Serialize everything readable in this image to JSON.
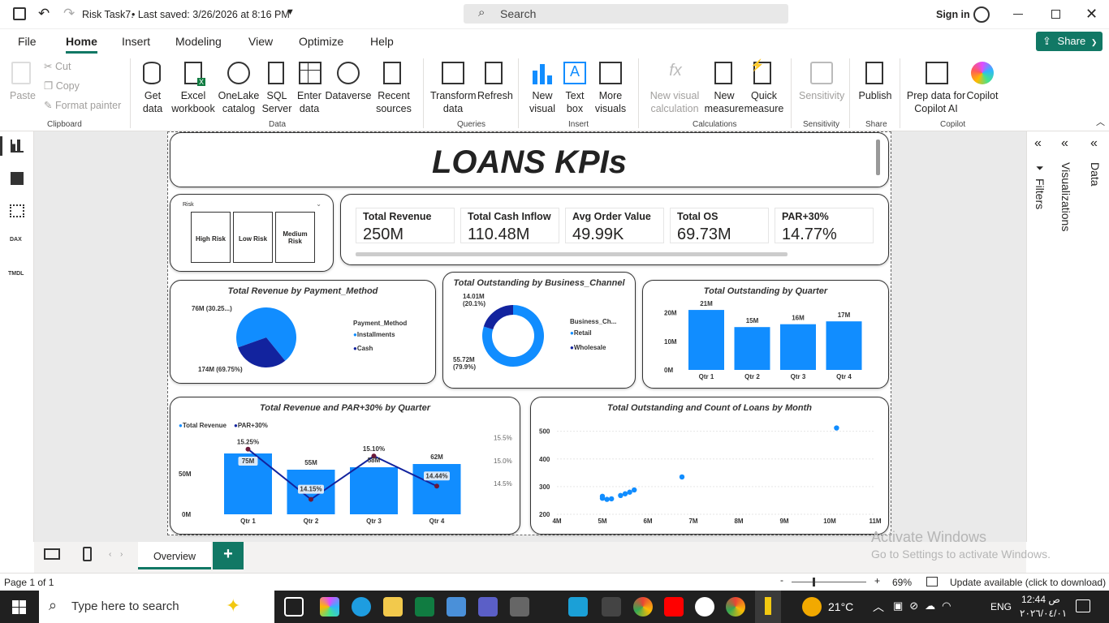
{
  "titlebar": {
    "file_title": "Risk Task7.",
    "saved": "• Last saved: 3/26/2026 at 8:16 PM",
    "search": "Search",
    "signin": "Sign in"
  },
  "menu": {
    "items": [
      "File",
      "Home",
      "Insert",
      "Modeling",
      "View",
      "Optimize",
      "Help"
    ],
    "share": "Share"
  },
  "ribbon": {
    "clipboard": {
      "paste": "Paste",
      "cut": "Cut",
      "copy": "Copy",
      "format_painter": "Format painter",
      "group": "Clipboard"
    },
    "data": {
      "get_data": "Get data",
      "excel": "Excel workbook",
      "onelake": "OneLake catalog",
      "sql": "SQL Server",
      "enter": "Enter data",
      "dataverse": "Dataverse",
      "recent": "Recent sources",
      "group": "Data"
    },
    "queries": {
      "transform": "Transform data",
      "refresh": "Refresh",
      "group": "Queries"
    },
    "insert": {
      "new_visual": "New visual",
      "text_box": "Text box",
      "more_visuals": "More visuals",
      "group": "Insert"
    },
    "calculations": {
      "new_visual_calc": "New visual calculation",
      "new_measure": "New measure",
      "quick_measure": "Quick measure",
      "group": "Calculations"
    },
    "sensitivity": {
      "label": "Sensitivity",
      "group": "Sensitivity"
    },
    "share": {
      "publish": "Publish",
      "group": "Share"
    },
    "copilot": {
      "prep": "Prep data for Copilot AI",
      "copilot": "Copilot",
      "group": "Copilot"
    }
  },
  "report": {
    "title": "LOANS KPIs",
    "slicer": {
      "label": "Risk",
      "options": [
        "High Risk",
        "Low Risk",
        "Medium Risk"
      ]
    },
    "kpis": [
      {
        "label": "Total Revenue",
        "value": "250M"
      },
      {
        "label": "Total Cash Inflow",
        "value": "110.48M"
      },
      {
        "label": "Avg Order Value",
        "value": "49.99K"
      },
      {
        "label": "Total OS",
        "value": "69.73M"
      },
      {
        "label": "PAR+30%",
        "value": "14.77%"
      }
    ]
  },
  "chart_data": [
    {
      "type": "pie",
      "title": "Total Revenue by Payment_Method",
      "legend_title": "Payment_Method",
      "slices": [
        {
          "name": "Installments",
          "value": 174,
          "label": "174M (69.75%)",
          "color": "#118dff"
        },
        {
          "name": "Cash",
          "value": 76,
          "label": "76M (30.25...)",
          "color": "#12239e"
        }
      ]
    },
    {
      "type": "pie",
      "title": "Total Outstanding by Business_Channel",
      "legend_title": "Business_Ch...",
      "slices": [
        {
          "name": "Retail",
          "value": 55.72,
          "label": "55.72M (79.9%)",
          "color": "#118dff"
        },
        {
          "name": "Wholesale",
          "value": 14.01,
          "label": "14.01M (20.1%)",
          "color": "#12239e"
        }
      ]
    },
    {
      "type": "bar",
      "title": "Total Outstanding by Quarter",
      "categories": [
        "Qtr 1",
        "Qtr 2",
        "Qtr 3",
        "Qtr 4"
      ],
      "values": [
        21,
        15,
        16,
        17
      ],
      "data_labels": [
        "21M",
        "15M",
        "16M",
        "17M"
      ],
      "yticks": [
        "0M",
        "10M",
        "20M"
      ],
      "ylim": [
        0,
        25
      ]
    },
    {
      "type": "bar",
      "title": "Total Revenue and PAR+30% by Quarter",
      "categories": [
        "Qtr 1",
        "Qtr 2",
        "Qtr 3",
        "Qtr 4"
      ],
      "series": [
        {
          "name": "Total Revenue",
          "values": [
            75,
            55,
            58,
            62
          ],
          "labels": [
            "75M",
            "55M",
            "58M",
            "62M"
          ]
        },
        {
          "name": "PAR+30%",
          "values": [
            15.25,
            14.15,
            15.1,
            14.44
          ],
          "labels": [
            "15.25%",
            "14.15%",
            "15.10%",
            "14.44%"
          ]
        }
      ],
      "yticks": [
        "0M",
        "50M"
      ],
      "y2ticks": [
        "14.5%",
        "15.0%",
        "15.5%"
      ]
    },
    {
      "type": "scatter",
      "title": "Total Outstanding and Count of Loans by Month",
      "xticks": [
        "4M",
        "5M",
        "6M",
        "7M",
        "8M",
        "9M",
        "10M",
        "11M"
      ],
      "yticks": [
        "200",
        "300",
        "400",
        "500"
      ],
      "points": [
        [
          5.0,
          258
        ],
        [
          5.0,
          265
        ],
        [
          5.1,
          254
        ],
        [
          5.2,
          256
        ],
        [
          5.4,
          268
        ],
        [
          5.5,
          274
        ],
        [
          5.6,
          280
        ],
        [
          5.7,
          288
        ],
        [
          6.75,
          335
        ],
        [
          10.15,
          512
        ]
      ],
      "xlim": [
        4,
        11
      ],
      "ylim": [
        200,
        540
      ]
    }
  ],
  "pages": {
    "tab": "Overview",
    "page": "Page 1 of 1",
    "zoom": "69%",
    "update": "Update available (click to download)"
  },
  "panes": {
    "filters": "Filters",
    "visualizations": "Visualizations",
    "data": "Data"
  },
  "watermark": {
    "line1": "Activate Windows",
    "line2": "Go to Settings to activate Windows."
  },
  "taskbar": {
    "search": "Type here to search",
    "temp": "21°C",
    "lang": "ENG",
    "time": "12:44 ص",
    "date": "٢٠٢٦/٠٤/٠١"
  }
}
